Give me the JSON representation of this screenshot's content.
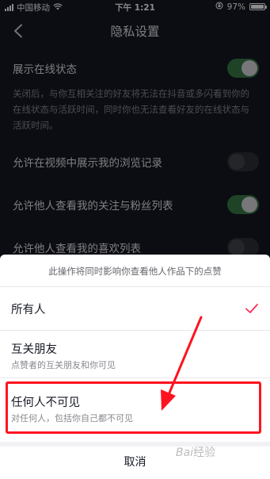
{
  "status_bar": {
    "carrier": "中国移动",
    "time": "下午 1:21",
    "battery_percent": "97%",
    "battery_level": 0.97
  },
  "header": {
    "title": "隐私设置"
  },
  "settings": {
    "online_status": {
      "label": "展示在线状态",
      "enabled": true,
      "description": "关闭后，与你互相关注的好友将无法在抖音或多闪看到你的在线状态与活跃时间，同时你也无法查看好友的在线状态与活跃时间。"
    },
    "browse_history": {
      "label": "允许在视频中展示我的浏览记录",
      "enabled": false
    },
    "follow_list": {
      "label": "允许他人查看我的关注与粉丝列表",
      "enabled": true
    },
    "likes_list": {
      "label": "允许他人查看我的喜欢列表",
      "enabled": false
    }
  },
  "sheet": {
    "hint": "此操作将同时影响你查看他人作品下的点赞",
    "options": [
      {
        "title": "所有人",
        "subtitle": "",
        "selected": true
      },
      {
        "title": "互关朋友",
        "subtitle": "点赞者的互关朋友和你可见",
        "selected": false
      },
      {
        "title": "任何人不可见",
        "subtitle": "对任何人，包括你自己都不可见",
        "selected": false
      }
    ],
    "cancel": "取消"
  },
  "colors": {
    "background": "#161823",
    "toggle_on": "#3a7a47",
    "check_accent": "#fe2c55",
    "annotation": "#ff1320"
  },
  "watermark": "Bai经验"
}
